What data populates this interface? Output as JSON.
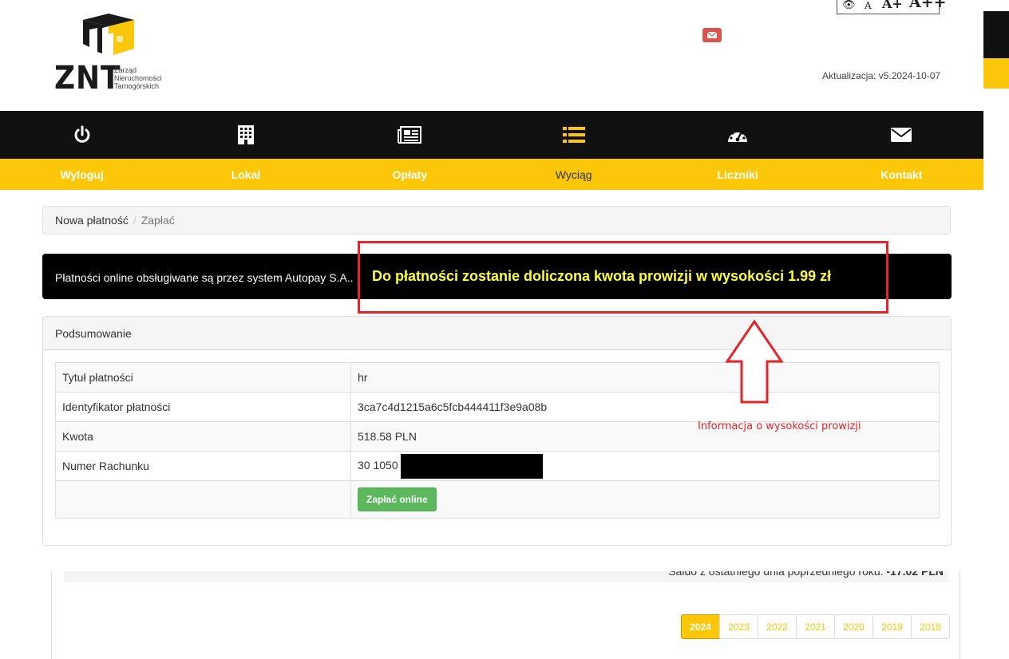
{
  "header": {
    "logo_text": "ZNT",
    "logo_subtitle_1": "Zarząd",
    "logo_subtitle_2": "Nieruchomości",
    "logo_subtitle_3": "Tarnogórskich",
    "accessibility": {
      "eye": "👁",
      "a_small": "A",
      "a_medium": "A+",
      "a_large": "A++"
    },
    "update_text": "Aktualizacja: v5.2024-10-07"
  },
  "nav": {
    "items": [
      {
        "label": "Wyloguj",
        "icon": "power-icon"
      },
      {
        "label": "Lokal",
        "icon": "building-icon"
      },
      {
        "label": "Opłaty",
        "icon": "newspaper-icon"
      },
      {
        "label": "Wyciąg",
        "icon": "list-icon"
      },
      {
        "label": "Liczniki",
        "icon": "gauge-icon"
      },
      {
        "label": "Kontakt",
        "icon": "envelope-icon"
      }
    ],
    "active_index": 3
  },
  "breadcrumb": {
    "item1": "Nowa płatność",
    "separator": "/",
    "item2": "Zapłać"
  },
  "info_bar": {
    "text": "Płatności online obsługiwane są przez system Autopay S.A..",
    "fee_text": "Do płatności zostanie doliczona kwota prowizji w wysokości 1.99 zł"
  },
  "summary": {
    "heading": "Podsumowanie",
    "rows": [
      {
        "label": "Tytuł płatności",
        "value": "hr"
      },
      {
        "label": "Identyfikator płatności",
        "value": "3ca7c4d1215a6c5fcb444411f3e9a08b"
      },
      {
        "label": "Kwota",
        "value": "518.58 PLN"
      },
      {
        "label": "Numer Rachunku",
        "value": "30 1050"
      }
    ],
    "pay_button": "Zapłać online"
  },
  "annotation": "Informacja o wysokości prowizji",
  "lower": {
    "saldo_text": "Saldo z ostatniego dnia poprzedniego roku: ",
    "saldo_value": "-17.02 PLN",
    "years": [
      "2024",
      "2023",
      "2022",
      "2021",
      "2020",
      "2019",
      "2018"
    ],
    "active_year": "2024"
  },
  "colors": {
    "yellow": "#fcc708",
    "black": "#111111",
    "red": "#e3242b",
    "green": "#5cb85c"
  }
}
